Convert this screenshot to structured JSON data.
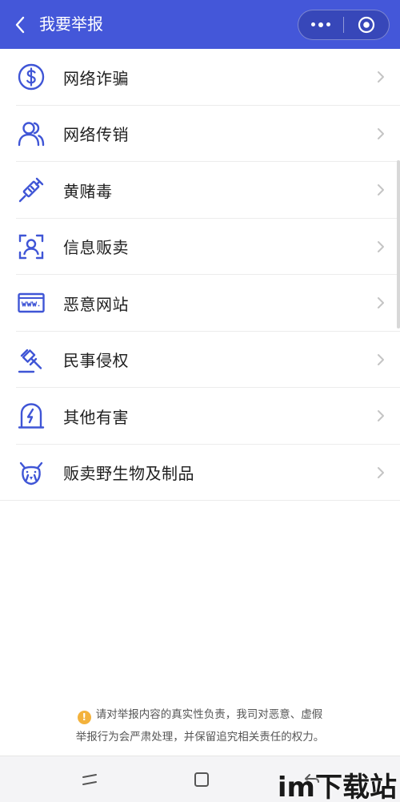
{
  "header": {
    "title": "我要举报",
    "background": "#4457d9"
  },
  "icons": {
    "back": "chevron-left-icon",
    "more": "more-dots-icon",
    "close": "target-circle-icon"
  },
  "accent_color": "#3f55d6",
  "list": {
    "items": [
      {
        "label": "网络诈骗",
        "icon": "dollar-coin-icon"
      },
      {
        "label": "网络传销",
        "icon": "people-icon"
      },
      {
        "label": "黄赌毒",
        "icon": "syringe-icon"
      },
      {
        "label": "信息贩卖",
        "icon": "face-scan-icon"
      },
      {
        "label": "恶意网站",
        "icon": "www-browser-icon"
      },
      {
        "label": "民事侵权",
        "icon": "gavel-icon"
      },
      {
        "label": "其他有害",
        "icon": "lightning-shield-icon"
      },
      {
        "label": "贩卖野生物及制品",
        "icon": "wild-animal-icon"
      }
    ]
  },
  "notice": {
    "line1": "请对举报内容的真实性负责，我司对恶意、虚假",
    "line2": "举报行为会严肃处理，并保留追究相关责任的权力。",
    "icon_color": "#f3b23c"
  },
  "navbar": {
    "icons": [
      "recent-apps-icon",
      "home-icon",
      "back-arrow-icon"
    ]
  },
  "watermark": {
    "text": "im下载站"
  }
}
